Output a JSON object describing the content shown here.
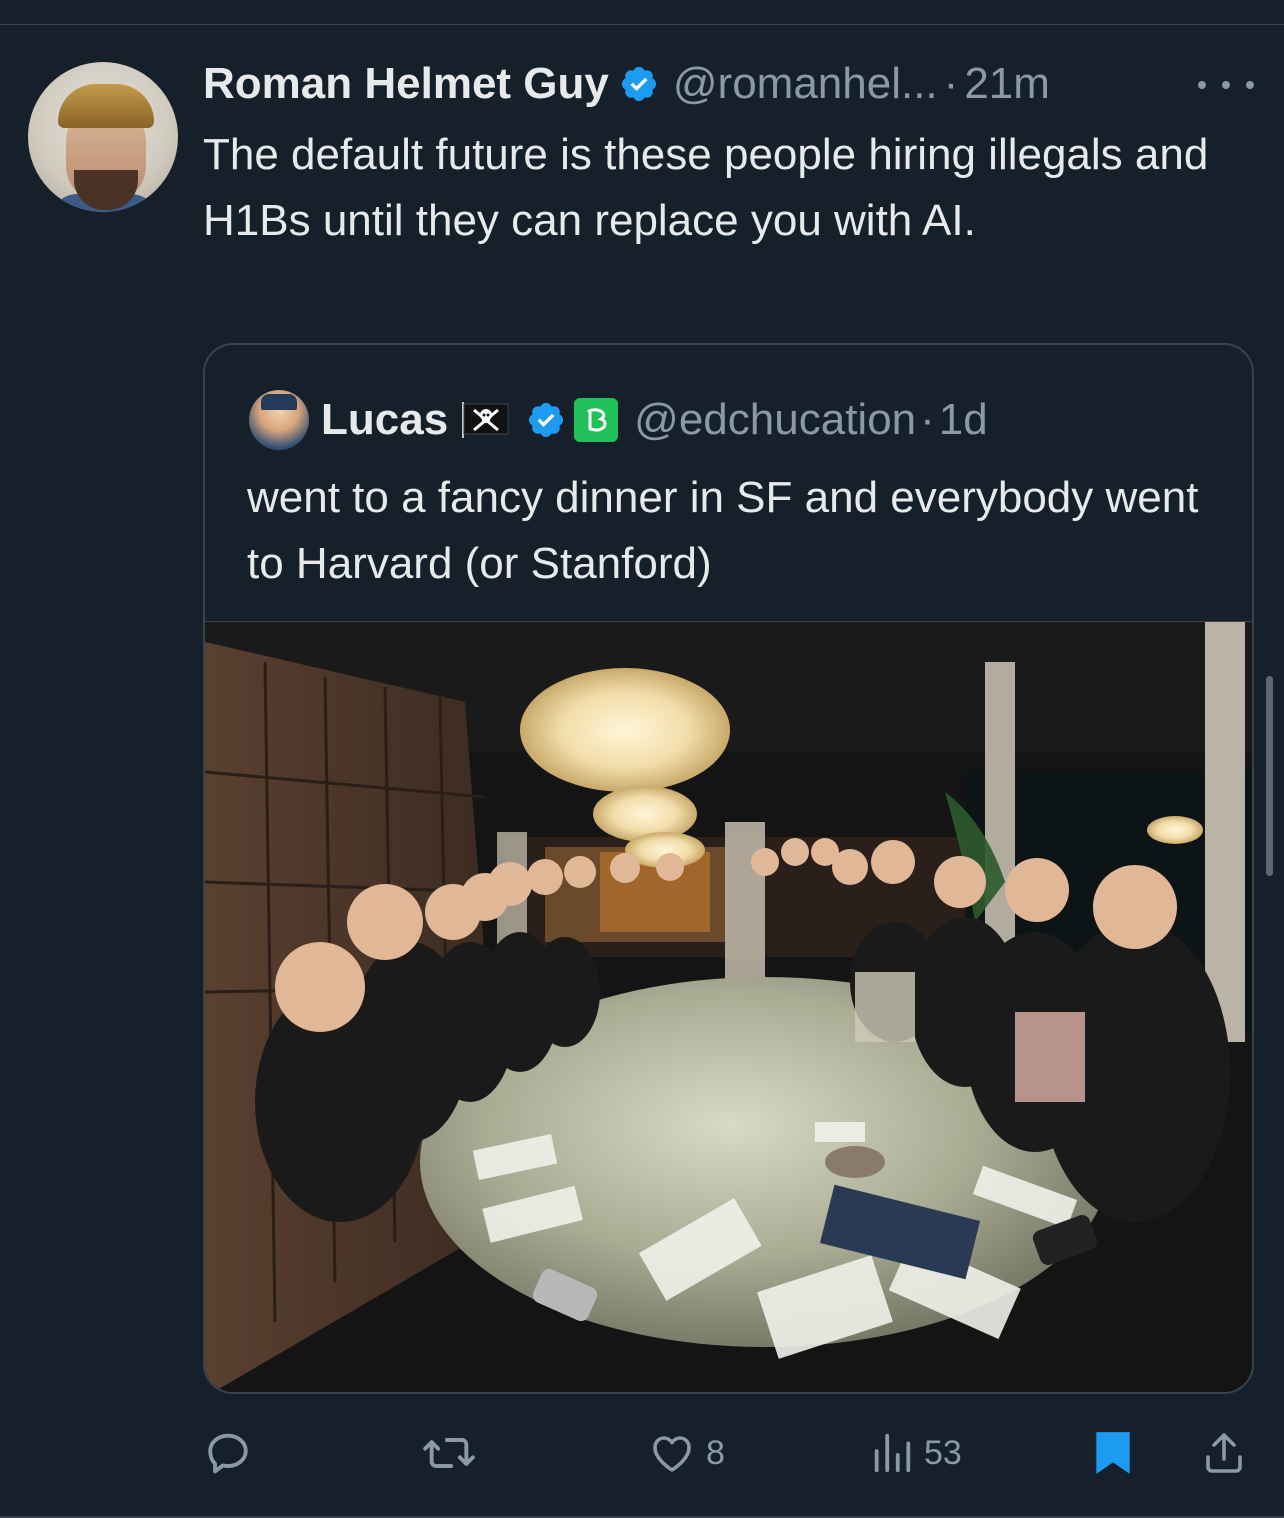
{
  "tweet": {
    "author_name": "Roman Helmet Guy",
    "handle": "@romanhel...",
    "separator": "·",
    "time": "21m",
    "text": "The default future is these people hiring illegals and H1Bs until they can replace you with AI."
  },
  "quoted": {
    "author_name": "Lucas",
    "handle": "@edchucation",
    "separator": "·",
    "time": "1d",
    "text": "went to a fancy dinner in SF and everybody went to Harvard (or Stanford)",
    "badge_glyph": "ℬ"
  },
  "actions": {
    "reply_count": "",
    "retweet_count": "",
    "like_count": "8",
    "views_count": "53"
  },
  "colors": {
    "background": "#15202b",
    "text": "#e7e9ea",
    "muted": "#8b98a5",
    "verified": "#1d9bf0",
    "bookmark": "#1d9bf0",
    "border": "#38444d"
  },
  "icons": [
    "more-icon",
    "verified-icon",
    "pirate-flag-icon",
    "affiliate-badge-icon",
    "reply-icon",
    "retweet-icon",
    "like-icon",
    "views-icon",
    "bookmark-icon",
    "share-icon"
  ]
}
